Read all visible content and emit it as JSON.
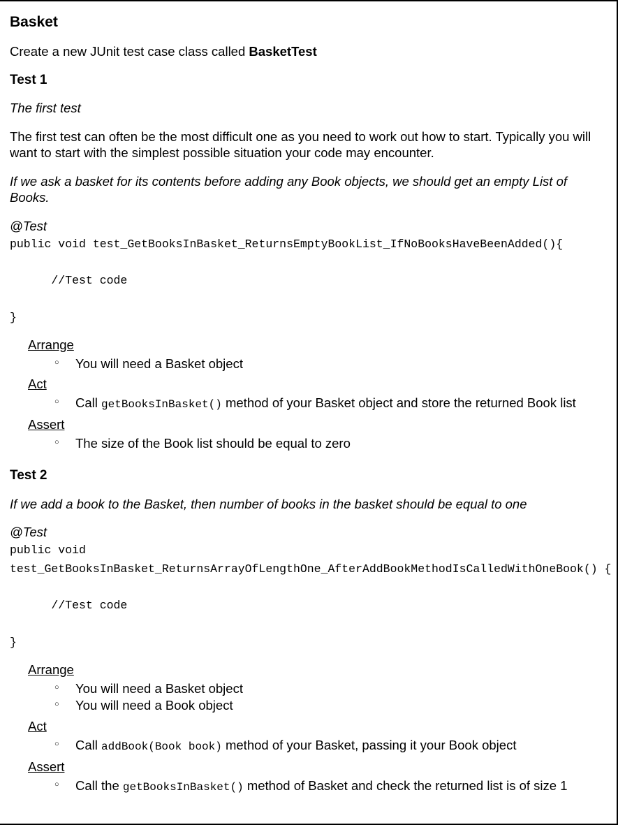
{
  "title": "Basket",
  "intro_prefix": "Create a new JUnit test case class called ",
  "intro_class": "BasketTest",
  "test1": {
    "heading": "Test 1",
    "subtitle": "The first test",
    "body": "The first test can often be the most difficult one as you need to work out how to start. Typically you will want to start with the simplest possible situation your code may encounter.",
    "scenario": "If we ask a basket for its contents before adding any Book objects, we should get an empty List of Books.",
    "annotation": "@Test",
    "code": "public void test_GetBooksInBasket_ReturnsEmptyBookList_IfNoBooksHaveBeenAdded(){\n\n      //Test code\n\n}",
    "arrange": {
      "label": "Arrange",
      "items": [
        "You will need a Basket object"
      ]
    },
    "act": {
      "label": "Act",
      "item_prefix": "Call ",
      "item_code": "getBooksInBasket()",
      "item_suffix": " method of your Basket object and store the returned Book list"
    },
    "assert": {
      "label": "Assert",
      "items": [
        "The size of the Book list should be equal to zero"
      ]
    }
  },
  "test2": {
    "heading": "Test 2",
    "scenario": "If we add a book to the Basket, then number of books in the basket should be equal to one",
    "annotation": "@Test",
    "code": "public void\ntest_GetBooksInBasket_ReturnsArrayOfLengthOne_AfterAddBookMethodIsCalledWithOneBook() {\n\n      //Test code\n\n}",
    "arrange": {
      "label": "Arrange",
      "items": [
        "You will need a Basket object",
        "You will need a Book object"
      ]
    },
    "act": {
      "label": "Act",
      "item_prefix": "Call ",
      "item_code": "addBook(Book book)",
      "item_suffix": " method of your Basket, passing it your Book object"
    },
    "assert": {
      "label": "Assert",
      "item_prefix": "Call the ",
      "item_code": "getBooksInBasket()",
      "item_suffix": " method of Basket and check the returned list is of size 1"
    }
  }
}
